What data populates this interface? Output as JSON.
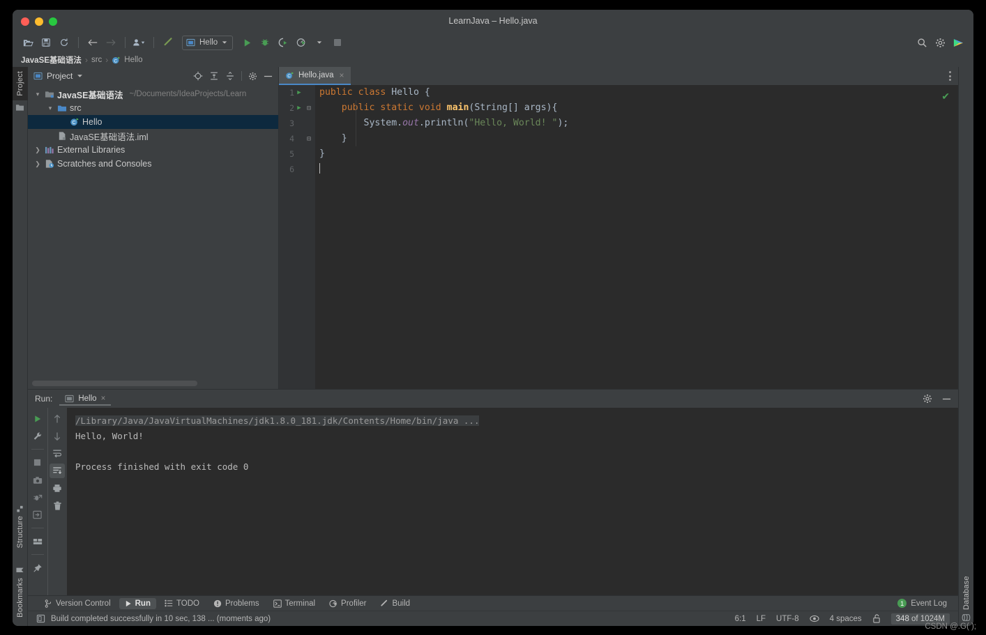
{
  "window": {
    "title": "LearnJava – Hello.java"
  },
  "toolbar": {
    "open_label": "open-project",
    "save_label": "save-all",
    "sync_label": "sync",
    "back_label": "back",
    "forward_label": "forward",
    "profile_label": "profile",
    "build_label": "build",
    "run_config": "Hello",
    "run_label": "Run",
    "debug_label": "Debug",
    "coverage_label": "Run with Coverage",
    "profiler_label": "Profiler",
    "stop_label": "Stop",
    "search_label": "Search Everywhere",
    "settings_label": "Settings"
  },
  "breadcrumb": {
    "items": [
      "JavaSE基础语法",
      "src",
      "Hello"
    ],
    "separator": "›"
  },
  "left_rail": {
    "top": "Project",
    "items": [
      "Structure",
      "Bookmarks"
    ]
  },
  "right_rail": {
    "items": [
      "Database"
    ]
  },
  "project_panel": {
    "title": "Project",
    "tree": [
      {
        "label": "JavaSE基础语法",
        "hint": "~/Documents/IdeaProjects/Learn",
        "depth": 0,
        "twist": "v",
        "icon": "module-icon",
        "bold": true,
        "selected": false
      },
      {
        "label": "src",
        "hint": "",
        "depth": 1,
        "twist": "v",
        "icon": "folder-icon",
        "bold": false,
        "selected": false
      },
      {
        "label": "Hello",
        "hint": "",
        "depth": 2,
        "twist": "",
        "icon": "java-class-icon",
        "bold": false,
        "selected": true
      },
      {
        "label": "JavaSE基础语法.iml",
        "hint": "",
        "depth": 1,
        "twist": "",
        "icon": "iml-icon",
        "bold": false,
        "selected": false
      },
      {
        "label": "External Libraries",
        "hint": "",
        "depth": 0,
        "twist": ">",
        "icon": "libraries-icon",
        "bold": false,
        "selected": false
      },
      {
        "label": "Scratches and Consoles",
        "hint": "",
        "depth": 0,
        "twist": ">",
        "icon": "scratches-icon",
        "bold": false,
        "selected": false
      }
    ]
  },
  "editor": {
    "tab": {
      "label": "Hello.java",
      "close": "×"
    },
    "inspection_status": "✔",
    "lines": [
      {
        "n": "1",
        "run": true,
        "fold": "",
        "tokens": [
          {
            "t": "public ",
            "c": "kw"
          },
          {
            "t": "class ",
            "c": "kw"
          },
          {
            "t": "Hello {",
            "c": "cls"
          }
        ]
      },
      {
        "n": "2",
        "run": true,
        "fold": "-",
        "tokens": [
          {
            "t": "    public ",
            "c": "kw"
          },
          {
            "t": "static ",
            "c": "kw"
          },
          {
            "t": "void ",
            "c": "kw"
          },
          {
            "t": "main",
            "c": "fn"
          },
          {
            "t": "(String[] args){",
            "c": "cls"
          }
        ]
      },
      {
        "n": "3",
        "run": false,
        "fold": "",
        "tokens": [
          {
            "t": "        System.",
            "c": "cls"
          },
          {
            "t": "out",
            "c": "stat"
          },
          {
            "t": ".println(",
            "c": "cls"
          },
          {
            "t": "\"Hello, World! \"",
            "c": "str"
          },
          {
            "t": ");",
            "c": "cls"
          }
        ]
      },
      {
        "n": "4",
        "run": false,
        "fold": "-",
        "tokens": [
          {
            "t": "    }",
            "c": "cls"
          }
        ]
      },
      {
        "n": "5",
        "run": false,
        "fold": "",
        "tokens": [
          {
            "t": "}",
            "c": "cls"
          }
        ]
      },
      {
        "n": "6",
        "run": false,
        "fold": "",
        "tokens": []
      }
    ]
  },
  "run_panel": {
    "label": "Run:",
    "tab": {
      "label": "Hello",
      "close": "×"
    },
    "console": [
      {
        "text": "/Library/Java/JavaVirtualMachines/jdk1.8.0_181.jdk/Contents/Home/bin/java ...",
        "style": "cmd"
      },
      {
        "text": "Hello, World!",
        "style": "out"
      },
      {
        "text": "",
        "style": "out"
      },
      {
        "text": "Process finished with exit code 0",
        "style": "out"
      }
    ],
    "tools_left": [
      "rerun-icon",
      "wrench-icon",
      "stop-icon",
      "camera-icon",
      "debug-icon",
      "import-icon",
      "layout-icon",
      "pin-icon"
    ],
    "tools_right": [
      "arrow-up-icon",
      "arrow-down-icon",
      "soft-wrap-icon",
      "scroll-to-end-icon",
      "print-icon",
      "trash-icon"
    ]
  },
  "tool_windows": {
    "items": [
      {
        "label": "Version Control",
        "icon": "vcs-icon",
        "active": false
      },
      {
        "label": "Run",
        "icon": "run-icon",
        "active": true
      },
      {
        "label": "TODO",
        "icon": "todo-icon",
        "active": false
      },
      {
        "label": "Problems",
        "icon": "problems-icon",
        "active": false
      },
      {
        "label": "Terminal",
        "icon": "terminal-icon",
        "active": false
      },
      {
        "label": "Profiler",
        "icon": "profiler-icon",
        "active": false
      },
      {
        "label": "Build",
        "icon": "build-icon",
        "active": false
      }
    ],
    "event_log": {
      "label": "Event Log",
      "count": "1"
    }
  },
  "status_bar": {
    "message": "Build completed successfully in 10 sec, 138 ... (moments ago)",
    "caret": "6:1",
    "line_sep": "LF",
    "encoding": "UTF-8",
    "indent": "4 spaces",
    "memory_used": "348",
    "memory_total": " of 1024M"
  },
  "watermark": "CSDN @.G( );",
  "colors": {
    "bg": "#3c3f41",
    "editor_bg": "#2b2b2b",
    "selection": "#0d293e",
    "accent": "#4a88c7",
    "green": "#499c54",
    "keyword": "#cc7832",
    "string": "#6a8759",
    "method": "#ffc66d",
    "static_field": "#9876aa"
  }
}
